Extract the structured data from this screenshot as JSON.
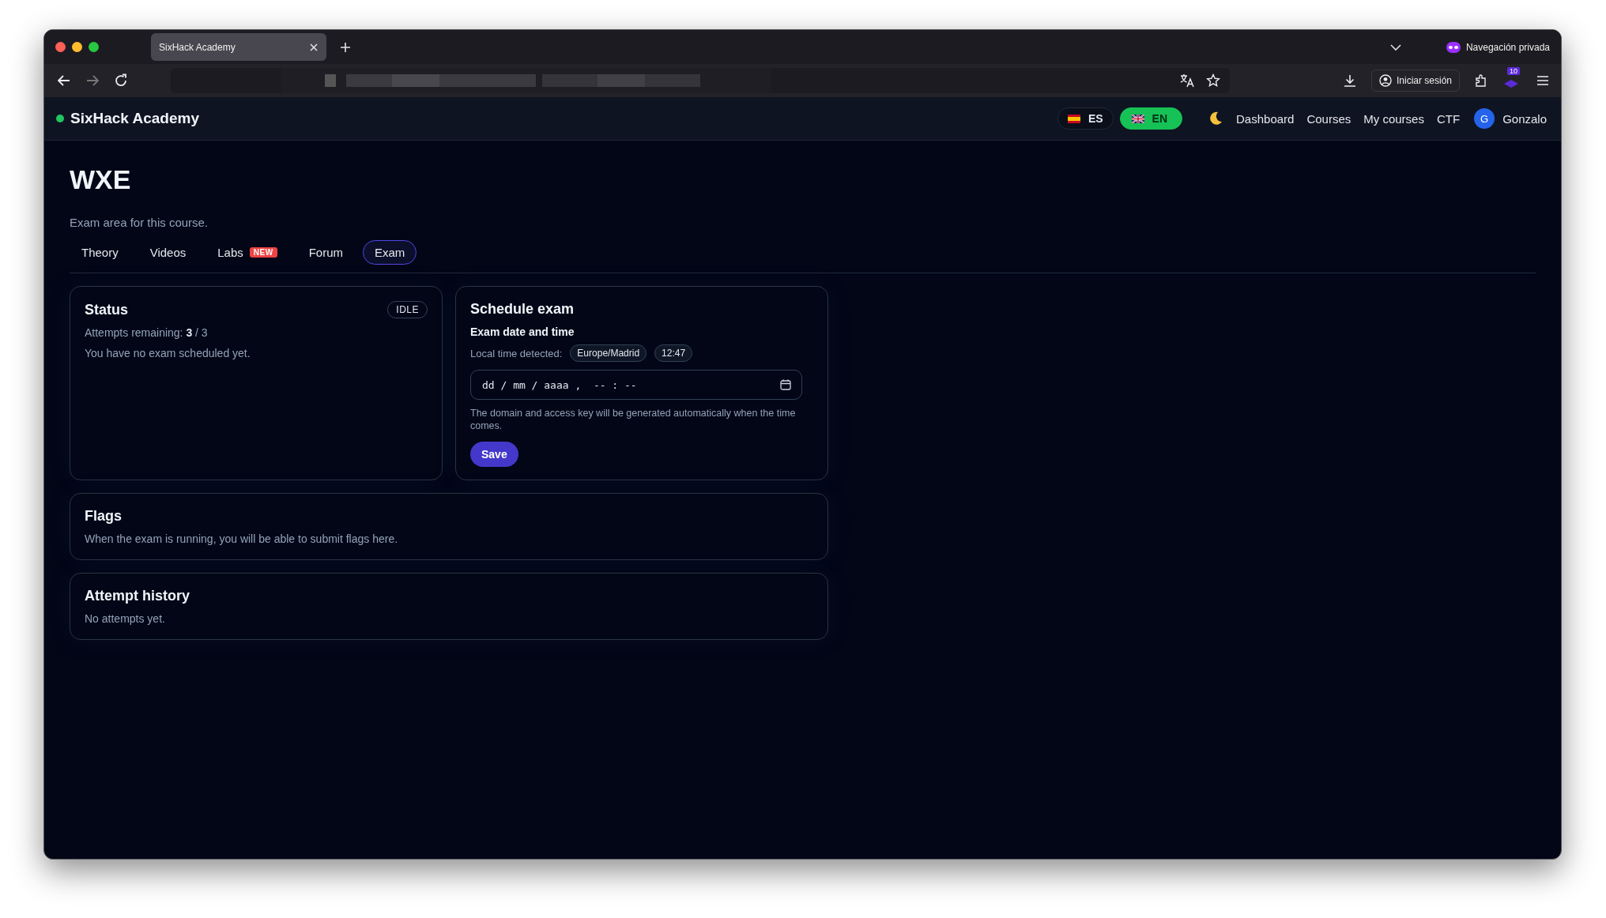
{
  "browser": {
    "tab_title": "SixHack Academy",
    "private_label": "Navegación privada",
    "sign_in": "Iniciar sesión",
    "extensions_badge": "10"
  },
  "app": {
    "brand": "SixHack Academy",
    "languages": [
      {
        "code": "ES",
        "kind": "spain",
        "selected": false
      },
      {
        "code": "EN",
        "kind": "uk",
        "selected": true
      }
    ],
    "nav": [
      "Dashboard",
      "Courses",
      "My courses",
      "CTF"
    ],
    "user": {
      "initial": "G",
      "name": "Gonzalo"
    }
  },
  "page": {
    "title": "WXE",
    "subtitle": "Exam area for this course.",
    "tabs": [
      {
        "label": "Theory",
        "selected": false
      },
      {
        "label": "Videos",
        "selected": false
      },
      {
        "label": "Labs",
        "badge": "NEW",
        "selected": false
      },
      {
        "label": "Forum",
        "selected": false
      },
      {
        "label": "Exam",
        "selected": true
      }
    ]
  },
  "status": {
    "title": "Status",
    "badge": "IDLE",
    "attempts": "Attempts remaining: **3** / 3",
    "message": "You have no exam scheduled yet."
  },
  "schedule": {
    "title": "Schedule exam",
    "field_label": "Exam date and time",
    "local_time_label": "Local time detected:",
    "timezone": "Europe/Madrid",
    "time": "12:47",
    "datetime": {
      "placeholder": "dd / mm / aaaa ,  -- : --"
    },
    "hint": "The domain and access key will be generated automatically when the time comes.",
    "save": "Save"
  },
  "flags": {
    "title": "Flags",
    "message": "When the exam is running, you will be able to submit flags here."
  },
  "history": {
    "title": "Attempt history",
    "message": "No attempts yet."
  }
}
